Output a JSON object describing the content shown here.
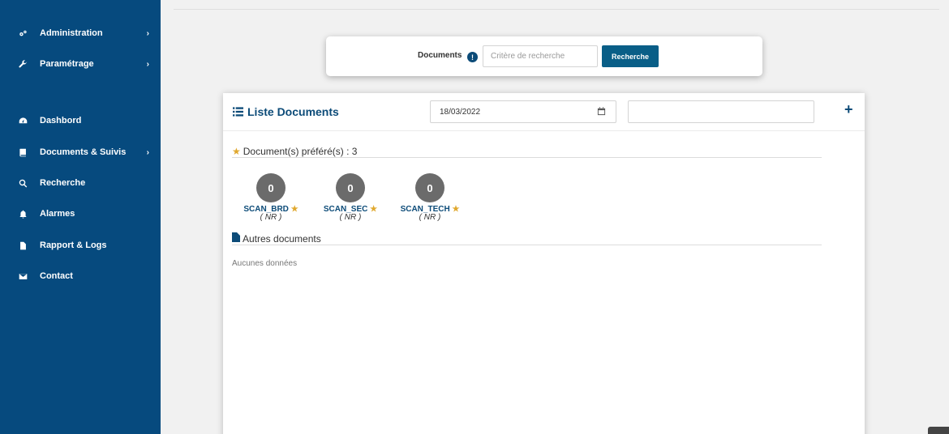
{
  "sidebar": {
    "items": [
      {
        "label": "Administration",
        "icon": "gears-icon",
        "chevron": "›"
      },
      {
        "label": "Paramétrage",
        "icon": "wrench-icon",
        "chevron": "›"
      },
      {
        "label": "Dashbord",
        "icon": "dashboard-icon"
      },
      {
        "label": "Documents & Suivis",
        "icon": "book-icon",
        "chevron": "›"
      },
      {
        "label": "Recherche",
        "icon": "search-icon"
      },
      {
        "label": "Alarmes",
        "icon": "bell-icon"
      },
      {
        "label": "Rapport & Logs",
        "icon": "file-icon"
      },
      {
        "label": "Contact",
        "icon": "envelope-icon"
      }
    ]
  },
  "search": {
    "label": "Documents",
    "info": "!",
    "placeholder": "Critère de recherche",
    "button": "Recherche"
  },
  "list": {
    "title": "Liste Documents",
    "date": "18/03/2022",
    "add": "+"
  },
  "favorites": {
    "title": "Document(s) préféré(s) : 3",
    "items": [
      {
        "name": "SCAN_BRD",
        "count": "0",
        "sub": "( NR )"
      },
      {
        "name": "SCAN_SEC",
        "count": "0",
        "sub": "( NR )"
      },
      {
        "name": "SCAN_TECH",
        "count": "0",
        "sub": "( NR )"
      }
    ]
  },
  "others": {
    "title": "Autres documents",
    "empty": "Aucunes données"
  },
  "colors": {
    "sidebar": "#064a7e",
    "accent": "#0c4b78",
    "button": "#095e87",
    "star": "#e0a82e"
  }
}
